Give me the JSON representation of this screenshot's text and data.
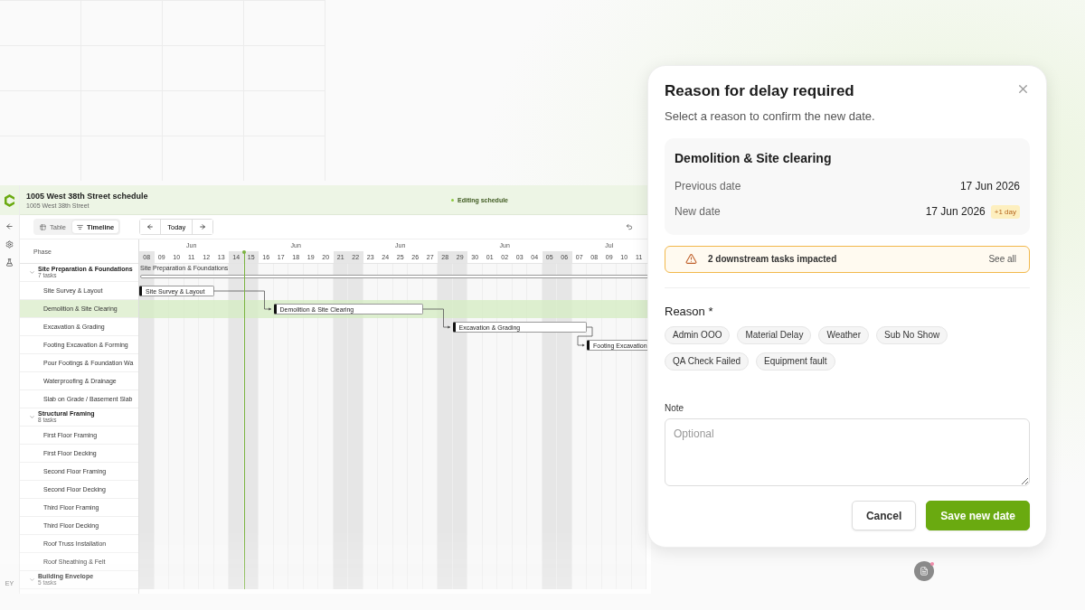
{
  "app": {
    "title": "1005 West 38th Street schedule",
    "subtitle": "1005 West 38th Street",
    "status": "Editing schedule",
    "avatar": "EY",
    "view_toggle": [
      {
        "label": "Table",
        "selected": false
      },
      {
        "label": "Timeline",
        "selected": true
      }
    ],
    "nav": {
      "today": "Today"
    }
  },
  "timeline": {
    "phase_header": "Phase",
    "months": [
      "Jun",
      "Jun",
      "Jun",
      "Jun",
      "Jul"
    ],
    "days": [
      {
        "label": "08",
        "weekend": true,
        "today": false
      },
      {
        "label": "09",
        "weekend": false,
        "today": false
      },
      {
        "label": "10",
        "weekend": false,
        "today": false
      },
      {
        "label": "11",
        "weekend": false,
        "today": false
      },
      {
        "label": "12",
        "weekend": false,
        "today": false
      },
      {
        "label": "13",
        "weekend": false,
        "today": false
      },
      {
        "label": "14",
        "weekend": true,
        "today": false
      },
      {
        "label": "15",
        "weekend": true,
        "today": true
      },
      {
        "label": "16",
        "weekend": false,
        "today": false
      },
      {
        "label": "17",
        "weekend": false,
        "today": false
      },
      {
        "label": "18",
        "weekend": false,
        "today": false
      },
      {
        "label": "19",
        "weekend": false,
        "today": false
      },
      {
        "label": "20",
        "weekend": false,
        "today": false
      },
      {
        "label": "21",
        "weekend": true,
        "today": false
      },
      {
        "label": "22",
        "weekend": true,
        "today": false
      },
      {
        "label": "23",
        "weekend": false,
        "today": false
      },
      {
        "label": "24",
        "weekend": false,
        "today": false
      },
      {
        "label": "25",
        "weekend": false,
        "today": false
      },
      {
        "label": "26",
        "weekend": false,
        "today": false
      },
      {
        "label": "27",
        "weekend": false,
        "today": false
      },
      {
        "label": "28",
        "weekend": true,
        "today": false
      },
      {
        "label": "29",
        "weekend": true,
        "today": false
      },
      {
        "label": "30",
        "weekend": false,
        "today": false
      },
      {
        "label": "01",
        "weekend": false,
        "today": false
      },
      {
        "label": "02",
        "weekend": false,
        "today": false
      },
      {
        "label": "03",
        "weekend": false,
        "today": false
      },
      {
        "label": "04",
        "weekend": false,
        "today": false
      },
      {
        "label": "05",
        "weekend": true,
        "today": false
      },
      {
        "label": "06",
        "weekend": true,
        "today": false
      },
      {
        "label": "07",
        "weekend": false,
        "today": false
      },
      {
        "label": "08",
        "weekend": false,
        "today": false
      },
      {
        "label": "09",
        "weekend": false,
        "today": false
      },
      {
        "label": "10",
        "weekend": false,
        "today": false
      },
      {
        "label": "11",
        "weekend": false,
        "today": false
      }
    ],
    "groups": [
      {
        "name": "Site Preparation & Foundations",
        "count": "7 tasks",
        "expanded": true,
        "bar_label": "Site Preparation & Foundations",
        "tasks": [
          {
            "name": "Site Survey & Layout",
            "selected": false,
            "bar_label": "Site Survey & Layout"
          },
          {
            "name": "Demolition & Site Clearing",
            "selected": true,
            "bar_label": "Demolition & Site Clearing"
          },
          {
            "name": "Excavation & Grading",
            "selected": false,
            "bar_label": "Excavation & Grading"
          },
          {
            "name": "Footing Excavation & Forming",
            "selected": false,
            "bar_label": "Footing Excavation"
          },
          {
            "name": "Pour Footings & Foundation Wa",
            "selected": false
          },
          {
            "name": "Waterproofing & Drainage",
            "selected": false
          },
          {
            "name": "Slab on Grade / Basement Slab",
            "selected": false
          }
        ]
      },
      {
        "name": "Structural Framing",
        "count": "8 tasks",
        "expanded": true,
        "tasks": [
          {
            "name": "First Floor Framing",
            "selected": false
          },
          {
            "name": "First Floor Decking",
            "selected": false
          },
          {
            "name": "Second Floor Framing",
            "selected": false
          },
          {
            "name": "Second Floor Decking",
            "selected": false
          },
          {
            "name": "Third Floor Framing",
            "selected": false
          },
          {
            "name": "Third Floor Decking",
            "selected": false
          },
          {
            "name": "Roof Truss Installation",
            "selected": false
          },
          {
            "name": "Roof Sheathing & Felt",
            "selected": false
          }
        ]
      },
      {
        "name": "Building Envelope",
        "count": "5 tasks",
        "expanded": true
      }
    ]
  },
  "dialog": {
    "title": "Reason for delay required",
    "subtitle": "Select a reason to confirm the new date.",
    "task": {
      "name": "Demolition & Site clearing",
      "previous_label": "Previous date",
      "previous_value": "17 Jun 2026",
      "new_label": "New date",
      "new_value": "17 Jun 2026",
      "delta": "+1 day"
    },
    "warning": {
      "text": "2 downstream tasks impacted",
      "link": "See all"
    },
    "reason_label": "Reason *",
    "reasons": [
      {
        "label": "Admin OOO",
        "selected": false
      },
      {
        "label": "Material Delay",
        "selected": false
      },
      {
        "label": "Weather",
        "selected": false
      },
      {
        "label": "Sub No Show",
        "selected": false
      },
      {
        "label": "QA Check Failed",
        "selected": false
      },
      {
        "label": "Equipment fault",
        "selected": false
      }
    ],
    "note_label": "Note",
    "note_placeholder": "Optional",
    "buttons": [
      {
        "label": "Cancel",
        "kind": "secondary"
      },
      {
        "label": "Save new date",
        "kind": "primary"
      }
    ]
  }
}
